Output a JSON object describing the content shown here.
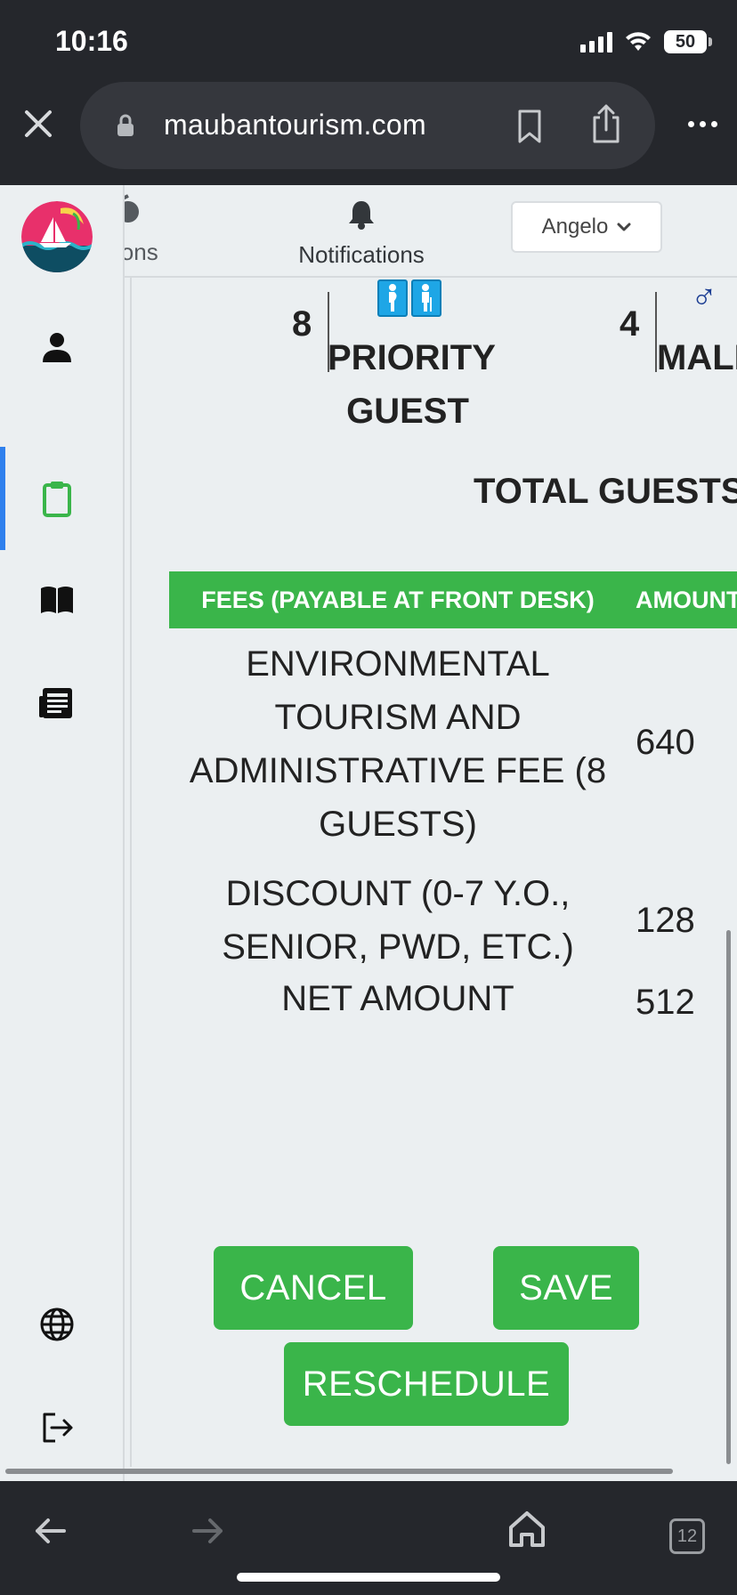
{
  "status_bar": {
    "time": "10:16",
    "battery": "50"
  },
  "browser": {
    "url": "maubantourism.com",
    "tab_count": "12"
  },
  "top_nav": {
    "cut_label": "ions",
    "notifications_label": "Notifications",
    "user_name": "Angelo"
  },
  "stats": {
    "priority_count": "8",
    "priority_label_line1": "PRIORITY",
    "priority_label_line2": "GUEST",
    "male_count": "4",
    "male_label": "MALE",
    "total_label": "TOTAL GUESTS"
  },
  "fees_table": {
    "headers": [
      "FEES (PAYABLE AT FRONT DESK)",
      "AMOUNT"
    ],
    "rows": [
      {
        "description": "ENVIRONMENTAL TOURISM AND ADMINISTRATIVE FEE (8 GUESTS)",
        "amount": "640"
      },
      {
        "description": "DISCOUNT (0-7 Y.O., SENIOR, PWD, ETC.)",
        "amount": "128"
      },
      {
        "description": "NET AMOUNT",
        "amount": "512"
      }
    ]
  },
  "actions": {
    "cancel": "CANCEL",
    "save": "SAVE",
    "reschedule": "RESCHEDULE"
  },
  "colors": {
    "accent_green": "#3ab54a",
    "active_nav_blue": "#2f80ed",
    "chrome_dark": "#25272c",
    "page_bg": "#ebeff1"
  },
  "icons": {
    "sidebar": [
      "person-icon",
      "clipboard-icon",
      "book-icon",
      "newspaper-icon",
      "globe-icon",
      "logout-icon"
    ],
    "bottom": [
      "back-arrow-icon",
      "forward-arrow-icon",
      "home-icon",
      "tabs-icon"
    ]
  }
}
